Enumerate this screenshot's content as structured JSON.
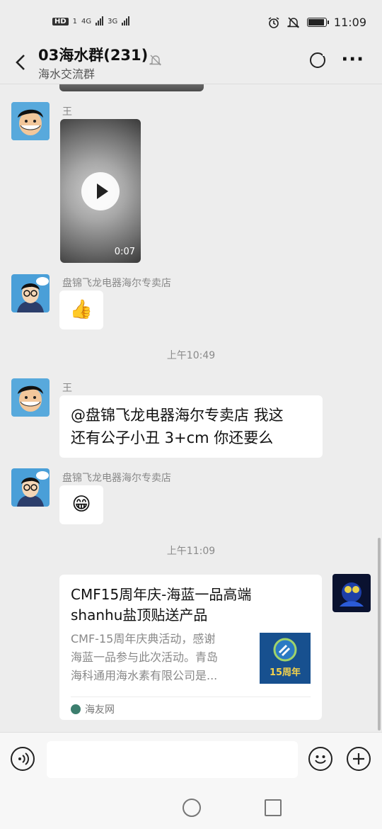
{
  "status_bar": {
    "hd": "HD",
    "sim1": "1",
    "net1": "4G",
    "net2": "3G",
    "time": "11:09",
    "battery_level": 0.85
  },
  "header": {
    "title": "03海水群(231)",
    "subtitle": "海水交流群",
    "icons": [
      "back-icon",
      "mute-bell-icon",
      "refresh-icon",
      "more-icon"
    ]
  },
  "messages": [
    {
      "sender": "王",
      "type": "video",
      "duration": "0:07"
    },
    {
      "sender": "盘锦飞龙电器海尔专卖店",
      "type": "emoji",
      "emoji": "👍"
    },
    {
      "timestamp": "上午10:49"
    },
    {
      "sender": "王",
      "type": "text",
      "text_line1": "@盘锦飞龙电器海尔专卖店  我这",
      "text_line2": "还有公子小丑  3+cm 你还要么"
    },
    {
      "sender": "盘锦飞龙电器海尔专卖店",
      "type": "emoji",
      "emoji": "😁"
    },
    {
      "timestamp": "上午11:09"
    },
    {
      "type": "link_card",
      "title_line1": "CMF15周年庆-海蓝一品高端",
      "title_line2": "shanhu盐顶贴送产品",
      "desc_line1": "CMF-15周年庆典活动，感谢",
      "desc_line2": "海蓝一品参与此次活动。青岛",
      "desc_line3": "海科通用海水素有限公司是...",
      "thumb_text": "15周年",
      "source": "海友网"
    }
  ],
  "input_bar": {
    "placeholder": "",
    "icons": [
      "voice-icon",
      "emoji-icon",
      "plus-icon"
    ]
  },
  "colors": {
    "background": "#ededed",
    "bubble": "#ffffff",
    "text": "#111111",
    "meta": "#888888"
  }
}
